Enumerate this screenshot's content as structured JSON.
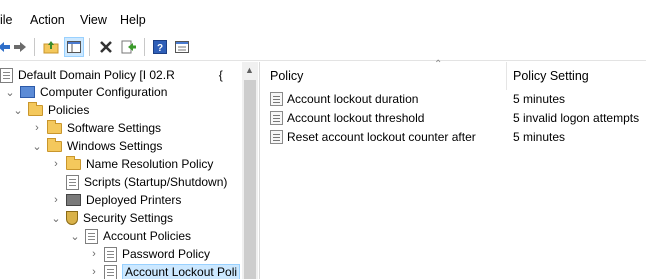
{
  "menubar": {
    "file": "ile",
    "action": "Action",
    "view": "View",
    "help": "Help"
  },
  "toolbar": {
    "buttons": [
      "back-icon",
      "forward-icon",
      "up-folder-icon",
      "show-hide-tree-icon",
      "delete-icon",
      "export-icon",
      "help-icon",
      "properties-icon"
    ]
  },
  "tree": {
    "root": "Default Domain Policy [I         02.R",
    "root_trailing": "{",
    "computer_configuration": "Computer Configuration",
    "policies": "Policies",
    "software_settings": "Software Settings",
    "windows_settings": "Windows Settings",
    "name_resolution_policy": "Name Resolution Policy",
    "scripts": "Scripts (Startup/Shutdown)",
    "deployed_printers": "Deployed Printers",
    "security_settings": "Security Settings",
    "account_policies": "Account Policies",
    "password_policy": "Password Policy",
    "account_lockout_policy": "Account Lockout Poli"
  },
  "list": {
    "col_policy": "Policy",
    "col_setting": "Policy Setting",
    "rows": [
      {
        "policy": "Account lockout duration",
        "setting": "5 minutes"
      },
      {
        "policy": "Account lockout threshold",
        "setting": "5 invalid logon attempts"
      },
      {
        "policy": "Reset account lockout counter after",
        "setting": "5 minutes"
      }
    ]
  }
}
